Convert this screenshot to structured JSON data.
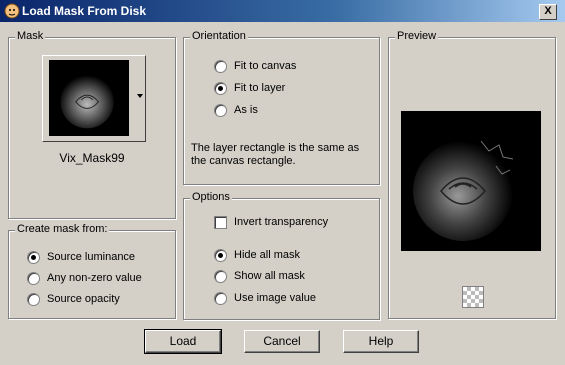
{
  "window": {
    "title": "Load Mask From Disk",
    "close_label": "X"
  },
  "mask": {
    "legend": "Mask",
    "name": "Vix_Mask99"
  },
  "create_from": {
    "legend": "Create mask from:",
    "options": [
      {
        "label": "Source luminance",
        "selected": true
      },
      {
        "label": "Any non-zero value",
        "selected": false
      },
      {
        "label": "Source opacity",
        "selected": false
      }
    ]
  },
  "orientation": {
    "legend": "Orientation",
    "options": [
      {
        "label": "Fit to canvas",
        "selected": false
      },
      {
        "label": "Fit to layer",
        "selected": true
      },
      {
        "label": "As is",
        "selected": false
      }
    ],
    "note": "The layer rectangle is the same as the canvas rectangle."
  },
  "options": {
    "legend": "Options",
    "invert_label": "Invert transparency",
    "invert_checked": false,
    "display": [
      {
        "label": "Hide all mask",
        "selected": true
      },
      {
        "label": "Show all mask",
        "selected": false
      },
      {
        "label": "Use image value",
        "selected": false
      }
    ]
  },
  "preview": {
    "legend": "Preview"
  },
  "buttons": {
    "load": "Load",
    "cancel": "Cancel",
    "help": "Help"
  }
}
